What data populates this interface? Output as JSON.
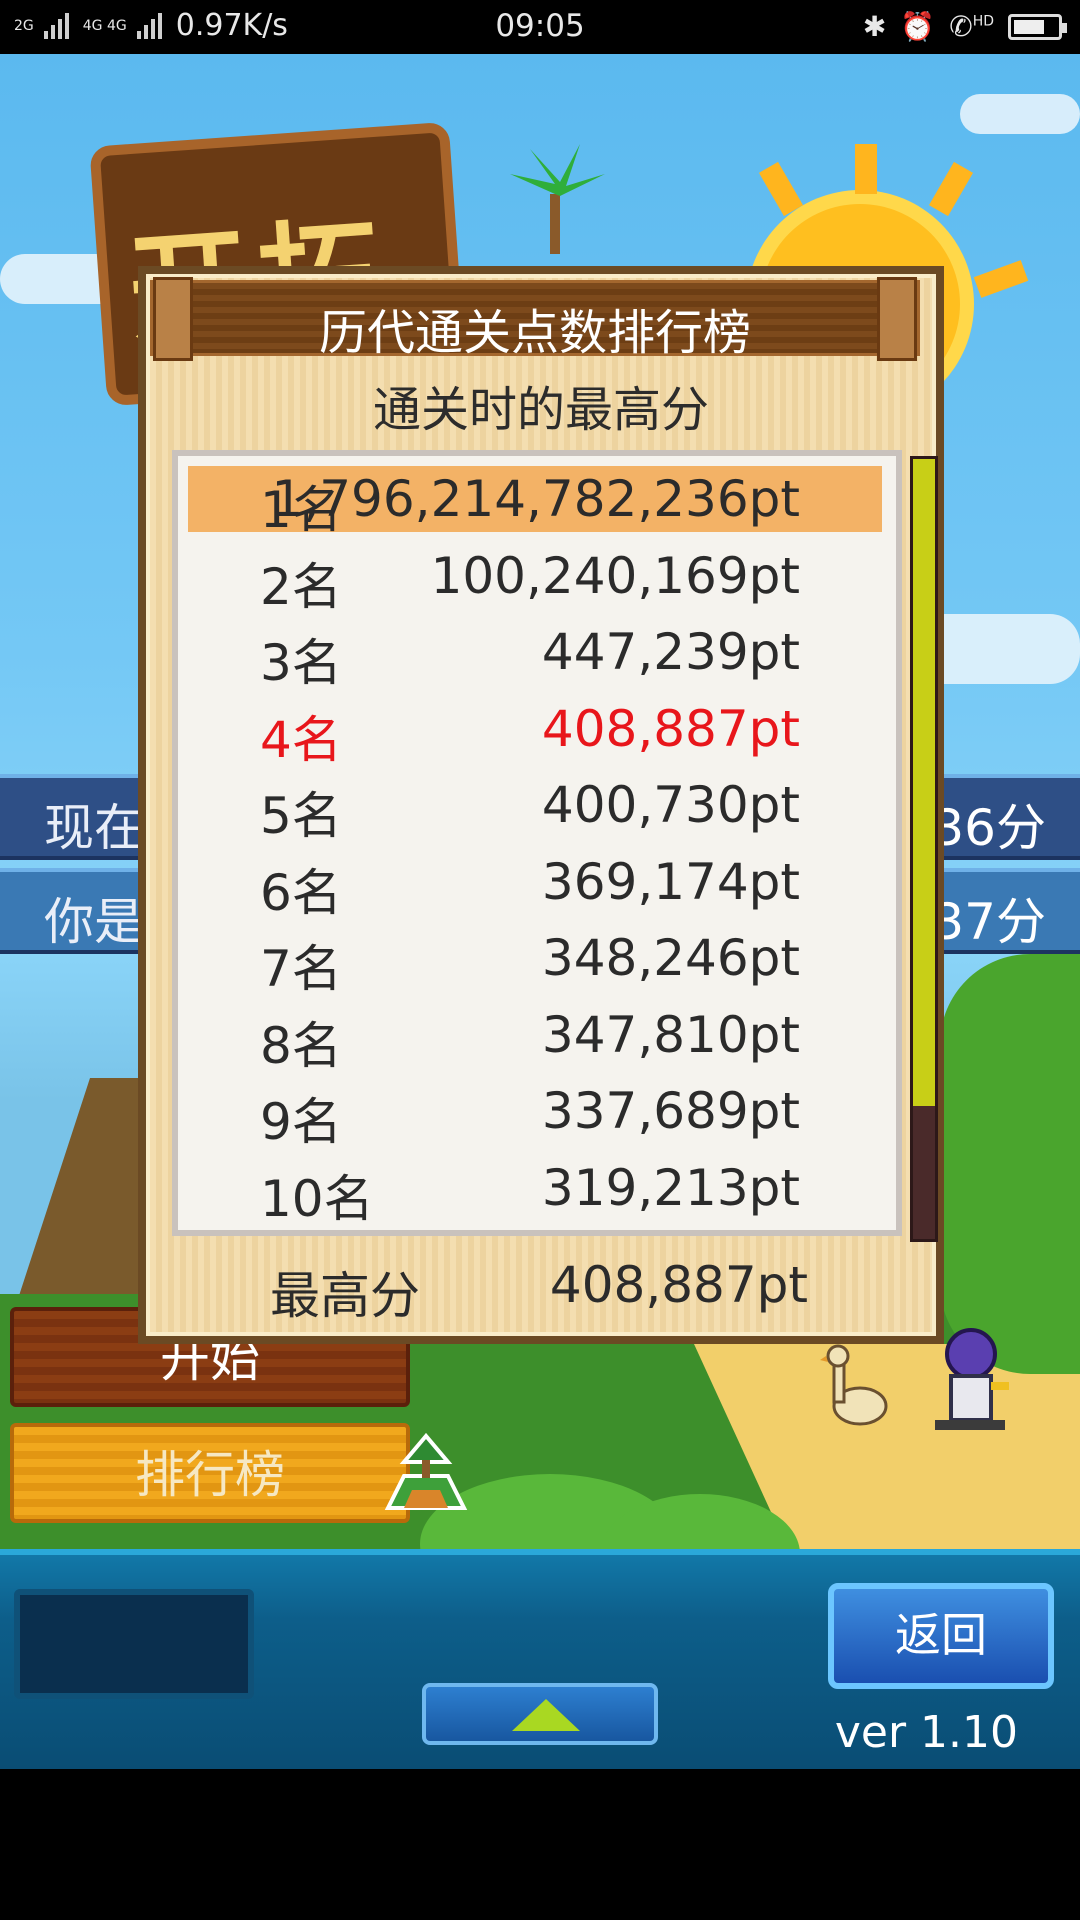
{
  "status_bar": {
    "network_left": "2G",
    "network_mid": "4G 4G",
    "speed": "0.97K/s",
    "time": "09:05",
    "call_label": "HD"
  },
  "scene": {
    "logo_text": "开拓",
    "info_bars": [
      {
        "left": "现在",
        "right": "36分"
      },
      {
        "left": "你是",
        "right": "37分"
      }
    ],
    "menu": {
      "start": "开始",
      "ranking": "排行榜"
    }
  },
  "leaderboard": {
    "title": "历代通关点数排行榜",
    "subtitle": "通关时的最高分",
    "rows": [
      {
        "rank": "1名",
        "score": "1,796,214,782,236pt"
      },
      {
        "rank": "2名",
        "score": "100,240,169pt"
      },
      {
        "rank": "3名",
        "score": "447,239pt"
      },
      {
        "rank": "4名",
        "score": "408,887pt"
      },
      {
        "rank": "5名",
        "score": "400,730pt"
      },
      {
        "rank": "6名",
        "score": "369,174pt"
      },
      {
        "rank": "7名",
        "score": "348,246pt"
      },
      {
        "rank": "8名",
        "score": "347,810pt"
      },
      {
        "rank": "9名",
        "score": "337,689pt"
      },
      {
        "rank": "10名",
        "score": "319,213pt"
      }
    ],
    "best_label": "最高分",
    "best_value": "408,887pt",
    "scroll_fraction": 0.83
  },
  "bottom_bar": {
    "back_label": "返回",
    "version": "ver 1.10"
  },
  "colors": {
    "highlight_row": "#f3b266",
    "self_row_text": "#e8161b",
    "scroll_thumb": "#c8cf17"
  }
}
